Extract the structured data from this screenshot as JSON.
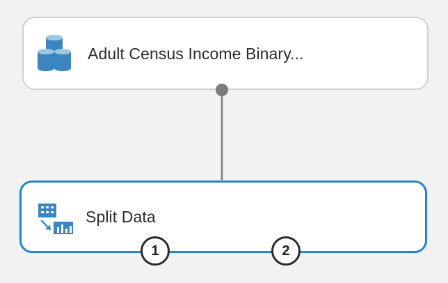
{
  "canvas": {
    "background": "#f2f2f2"
  },
  "modules": {
    "dataset": {
      "label": "Adult Census Income Binary...",
      "icon": "database-icon",
      "border_color": "#cfcfcf",
      "selected": false
    },
    "split": {
      "label": "Split Data",
      "icon": "split-data-icon",
      "border_color": "#2f84c4",
      "selected": true,
      "output_ports": [
        "1",
        "2"
      ]
    }
  },
  "connector": {
    "color": "#7b7b7b",
    "from": "dataset",
    "to": "split"
  },
  "colors": {
    "icon_blue": "#3b86c1",
    "selection_blue": "#2f84c4"
  }
}
